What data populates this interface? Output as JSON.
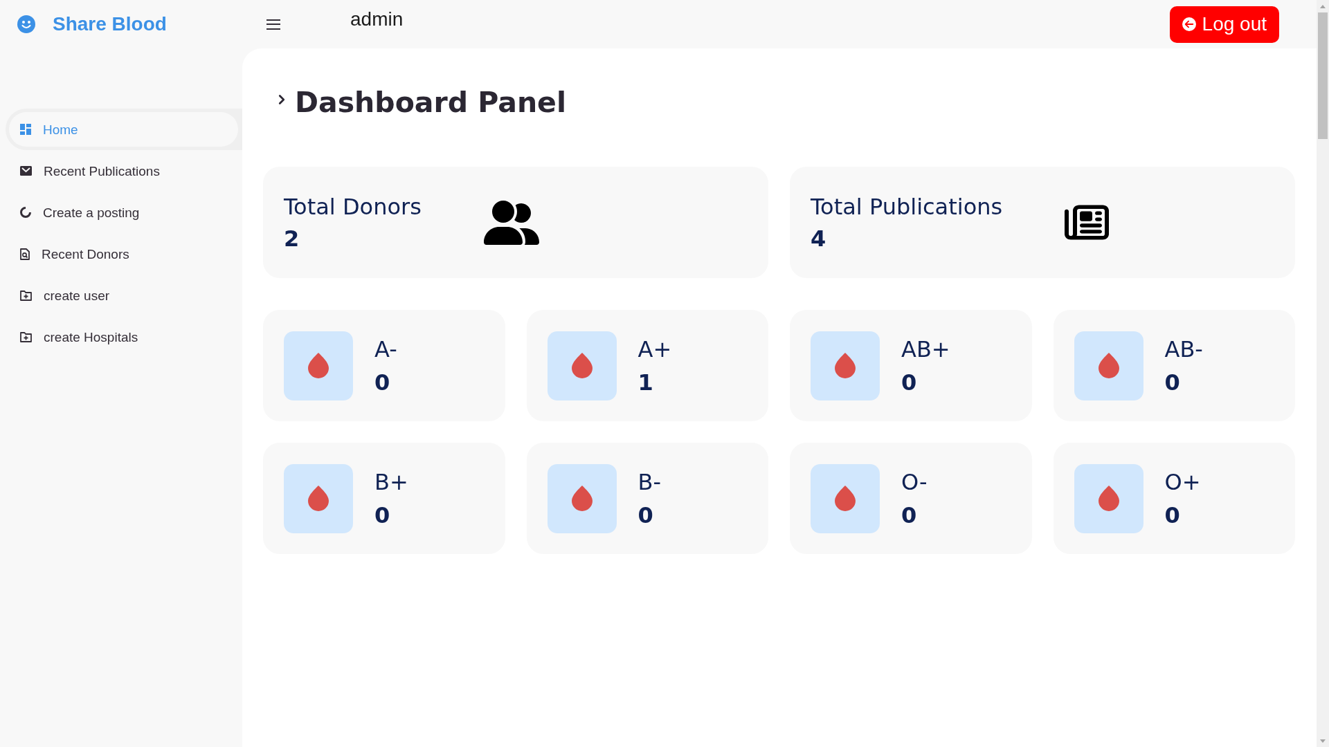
{
  "header": {
    "brand": "Share Blood",
    "user": "admin",
    "logout_button": "Log out"
  },
  "sidebar": {
    "items": [
      {
        "label": "Home",
        "selected": true
      },
      {
        "label": "Recent Publications",
        "selected": false
      },
      {
        "label": "Create a posting",
        "selected": false
      },
      {
        "label": "Recent Donors",
        "selected": false
      },
      {
        "label": "create user",
        "selected": false
      },
      {
        "label": "create Hospitals",
        "selected": false
      }
    ]
  },
  "page_title": "Dashboard Panel",
  "stats": [
    {
      "label": "Total Donors",
      "value": "2"
    },
    {
      "label": "Total Publications",
      "value": "4"
    }
  ],
  "blood_groups": [
    {
      "group": "A-",
      "count": "0"
    },
    {
      "group": "A+",
      "count": "1"
    },
    {
      "group": "AB+",
      "count": "0"
    },
    {
      "group": "AB-",
      "count": "0"
    },
    {
      "group": "B+",
      "count": "0"
    },
    {
      "group": "B-",
      "count": "0"
    },
    {
      "group": "O-",
      "count": "0"
    },
    {
      "group": "O+",
      "count": "0"
    }
  ]
}
